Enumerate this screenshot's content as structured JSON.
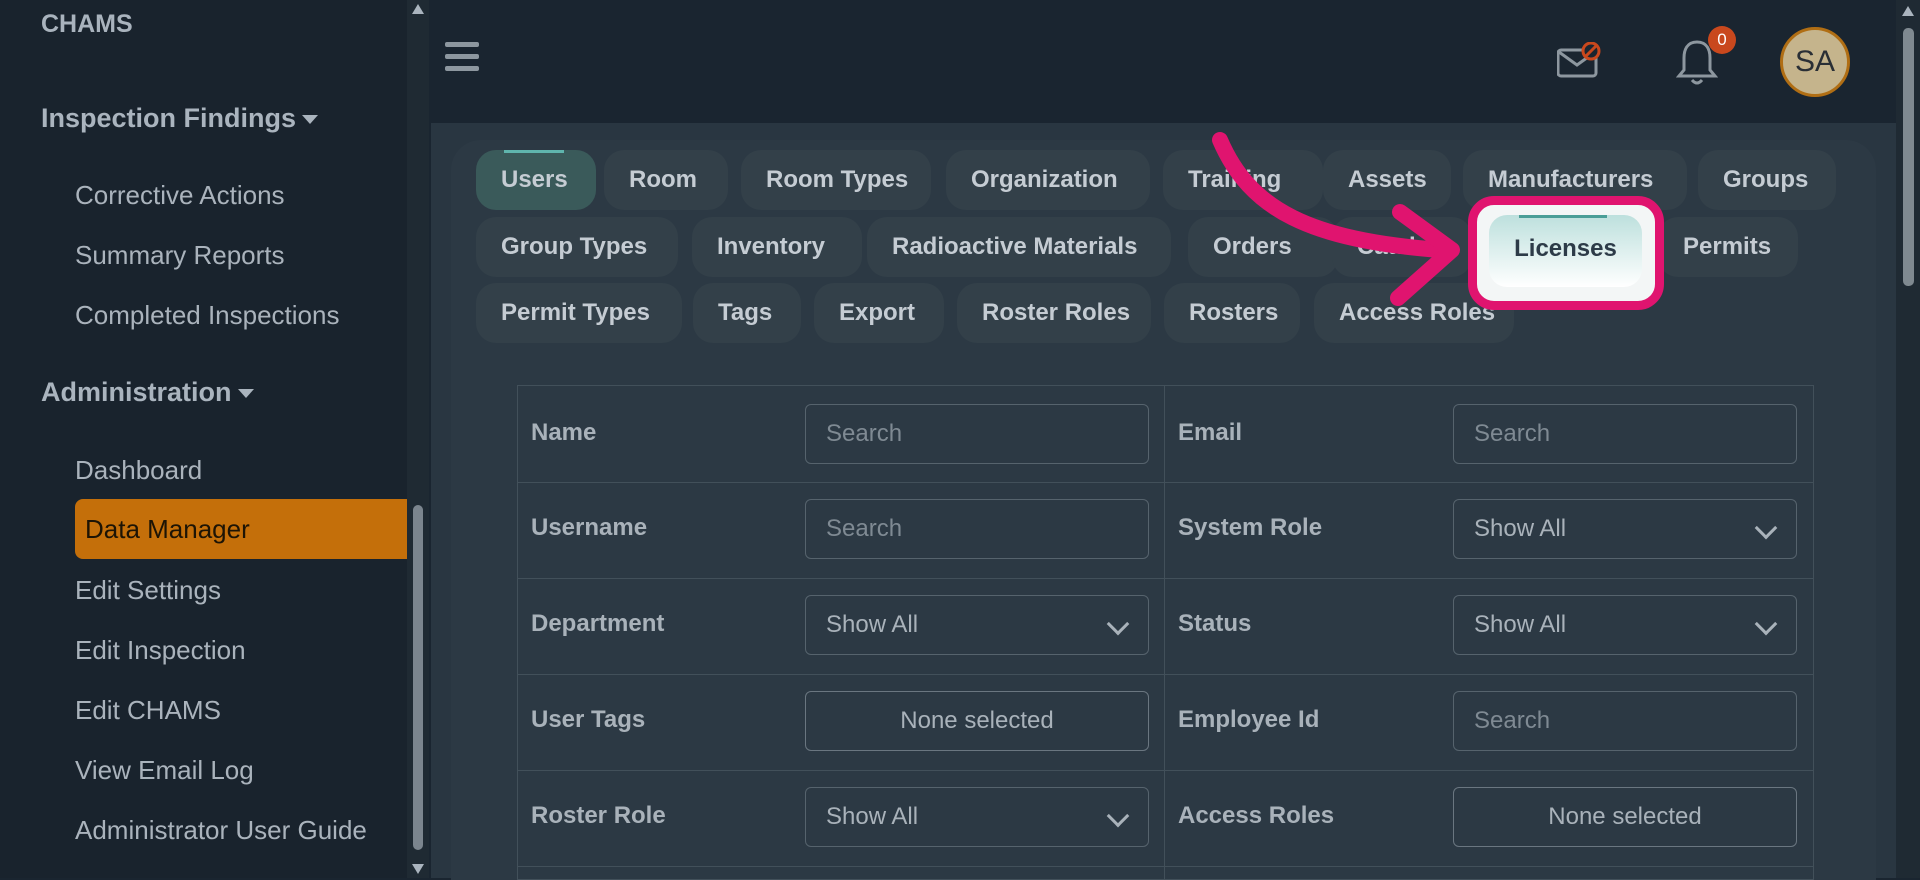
{
  "sidebar": {
    "brand": "CHAMS",
    "section_inspection": "Inspection Findings",
    "inspection_items": [
      "Corrective Actions",
      "Summary Reports",
      "Completed Inspections"
    ],
    "section_admin": "Administration",
    "admin_items": [
      "Dashboard",
      "Data Manager",
      "Edit Settings",
      "Edit Inspection",
      "Edit CHAMS",
      "View Email Log",
      "Administrator User Guide"
    ],
    "active_item": "Data Manager"
  },
  "header": {
    "notification_count": "0",
    "avatar_initials": "SA"
  },
  "tabs": [
    "Users",
    "Room",
    "Room Types",
    "Organization",
    "Training",
    "Assets",
    "Manufacturers",
    "Groups",
    "Group Types",
    "Inventory",
    "Radioactive Materials",
    "Orders",
    "Catalog",
    "Licenses",
    "Permits",
    "Permit Types",
    "Tags",
    "Export",
    "Roster Roles",
    "Rosters",
    "Access Roles"
  ],
  "selected_tab": "Users",
  "highlighted_tab": "Licenses",
  "filters": {
    "name_label": "Name",
    "name_placeholder": "Search",
    "email_label": "Email",
    "email_placeholder": "Search",
    "username_label": "Username",
    "username_placeholder": "Search",
    "system_role_label": "System Role",
    "system_role_value": "Show All",
    "department_label": "Department",
    "department_value": "Show All",
    "status_label": "Status",
    "status_value": "Show All",
    "user_tags_label": "User Tags",
    "user_tags_value": "None selected",
    "employee_id_label": "Employee Id",
    "employee_id_placeholder": "Search",
    "roster_role_label": "Roster Role",
    "roster_role_value": "Show All",
    "access_roles_label": "Access Roles",
    "access_roles_value": "None selected"
  },
  "colors": {
    "sidebar_bg": "#19232d",
    "active_item_bg": "#c46f0a",
    "highlight": "#e0146f",
    "badge": "#c9481d"
  }
}
